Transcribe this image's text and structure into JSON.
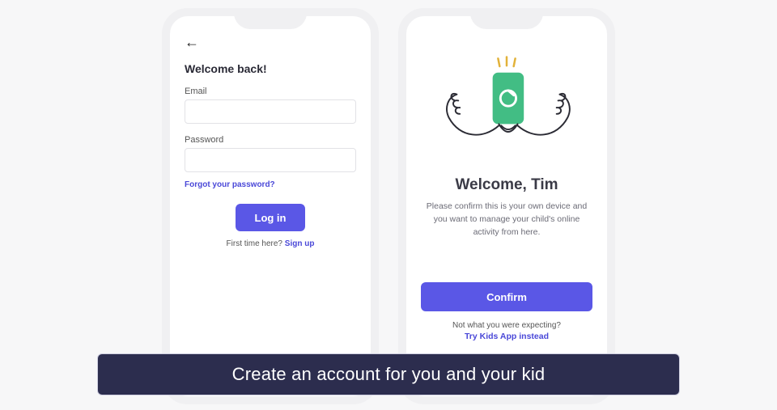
{
  "left": {
    "title": "Welcome back!",
    "email_label": "Email",
    "email_value": "",
    "password_label": "Password",
    "password_value": "",
    "forgot": "Forgot your password?",
    "login_btn": "Log in",
    "first_time_prefix": "First time here? ",
    "signup": "Sign up"
  },
  "right": {
    "welcome_heading": "Welcome, Tim",
    "welcome_body": "Please confirm this is your own device and you want to manage your child's online activity from here.",
    "confirm_btn": "Confirm",
    "not_expecting": "Not what you were expecting?",
    "try_kids": "Try Kids App instead"
  },
  "caption": "Create an account for you and your kid",
  "colors": {
    "accent": "#5a57e6",
    "link": "#4a48d8",
    "caption_bg": "#2c2d4e"
  }
}
